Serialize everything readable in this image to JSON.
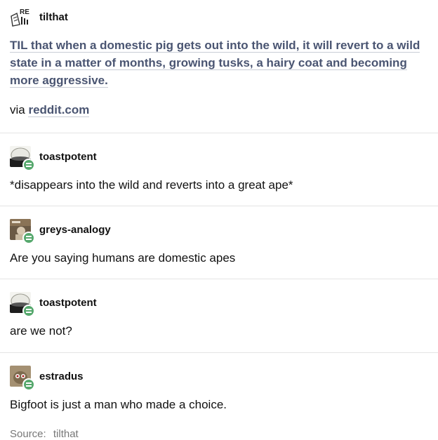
{
  "post": {
    "op": {
      "username": "tilthat",
      "avatar_text": "RE",
      "title": "TIL that when a domestic pig gets out into the wild, it will revert to a wild state in a matter of months, growing tusks, a hairy coat and becoming more aggressive.",
      "via_label": "via",
      "via_link": "reddit.com"
    },
    "replies": [
      {
        "username": "toastpotent",
        "text": "*disappears into the wild and reverts into a great ape*"
      },
      {
        "username": "greys-analogy",
        "text": "Are you saying humans are domestic apes"
      },
      {
        "username": "toastpotent",
        "text": "are we not?"
      },
      {
        "username": "estradus",
        "text": "Bigfoot is just a man who made a choice."
      }
    ],
    "source": {
      "label": "Source:",
      "value": "tilthat"
    }
  },
  "colors": {
    "link": "#4a5572",
    "badge": "#56a86d",
    "divider": "#e4e4e4",
    "muted": "#777777"
  }
}
